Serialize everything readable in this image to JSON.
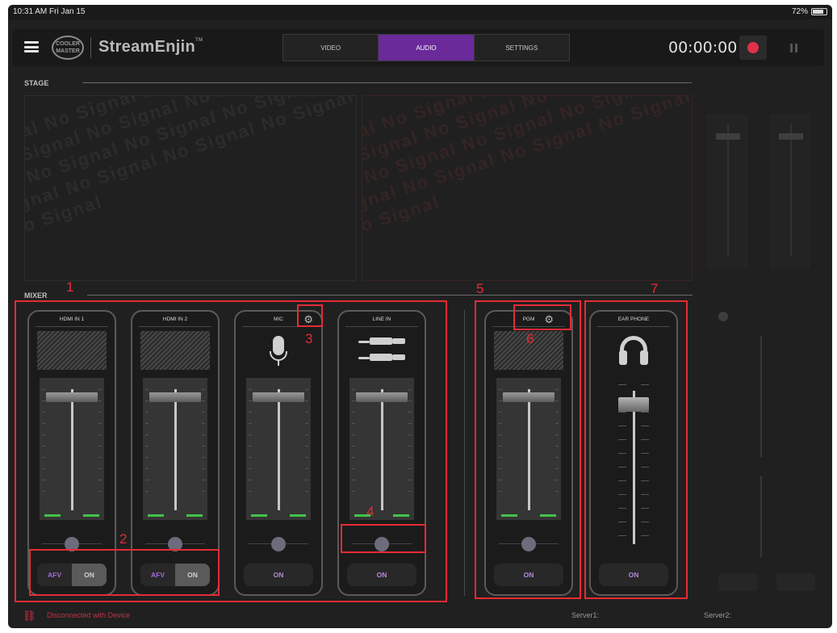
{
  "status_bar": {
    "time": "10:31 AM  Fri Jan 15",
    "battery": "72%"
  },
  "header": {
    "logo_text": "COOLER MASTER",
    "app_name": "StreamEnjin",
    "trademark": "TM",
    "tabs": [
      {
        "label": "VIDEO"
      },
      {
        "label": "AUDIO"
      },
      {
        "label": "SETTINGS"
      }
    ],
    "active_tab": "AUDIO",
    "timer": "00:00:00"
  },
  "stage": {
    "label": "STAGE",
    "watermark": "No Signal No Signal No Signal No Signal No Signal No Signal No Signal No Signal No Signal No Signal No Signal No Signal No Signal No Signal No Signal No Signal No Signal No Signal No Signal No Signal"
  },
  "mixer": {
    "label": "MIXER",
    "channels": [
      {
        "title": "HDMI IN 1",
        "afv": "AFV",
        "on": "ON"
      },
      {
        "title": "HDMI IN 2",
        "afv": "AFV",
        "on": "ON"
      },
      {
        "title": "MIC",
        "on": "ON"
      },
      {
        "title": "LINE IN",
        "on": "ON"
      },
      {
        "title": "PGM",
        "on": "ON"
      },
      {
        "title": "EAR PHONE",
        "on": "ON"
      }
    ]
  },
  "callouts": [
    "1",
    "2",
    "3",
    "4",
    "5",
    "6",
    "7"
  ],
  "footer": {
    "status": "Disconnected with Device",
    "server1": "Server1:",
    "server2": "Server2:"
  },
  "colors": {
    "accent": "#6a2a9a",
    "record": "#e0314b",
    "callout": "#e52b35",
    "meter": "#43c34a"
  }
}
